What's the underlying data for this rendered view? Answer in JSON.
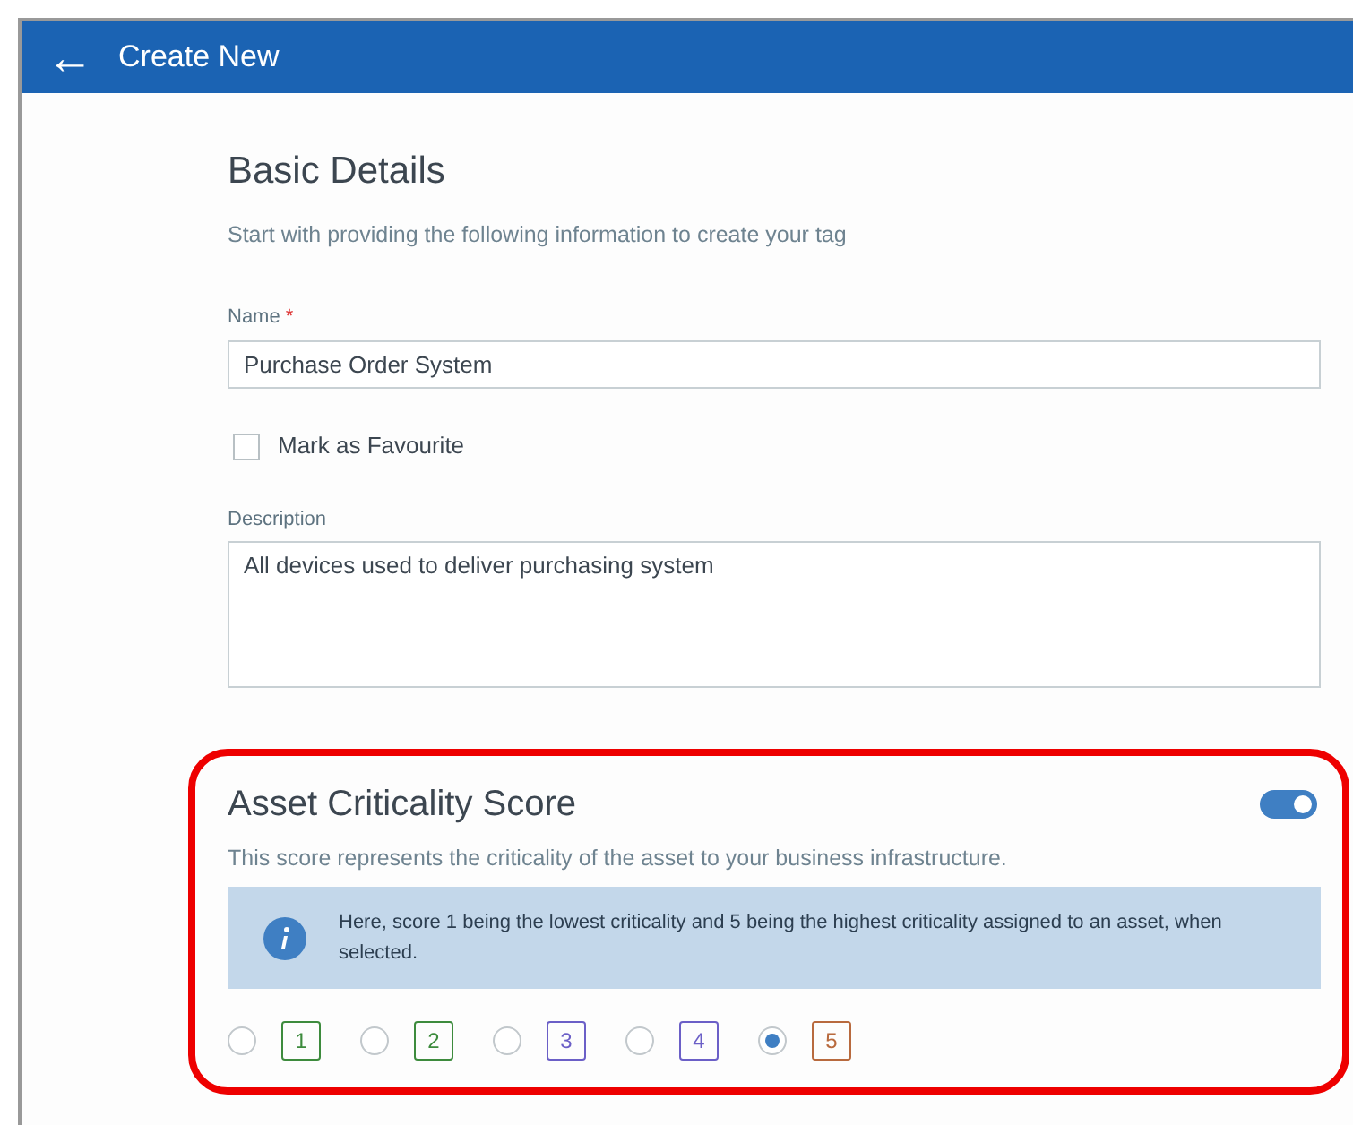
{
  "header": {
    "back_icon": "←",
    "title": "Create New"
  },
  "basic_details": {
    "title": "Basic Details",
    "subtitle": "Start with providing the following information to create your tag",
    "name_label": "Name",
    "required_mark": "*",
    "name_value": "Purchase Order System",
    "favourite": {
      "label": "Mark as Favourite",
      "checked": false
    },
    "description_label": "Description",
    "description_value": "All devices used to deliver purchasing system"
  },
  "criticality": {
    "title": "Asset Criticality Score",
    "enabled": true,
    "subtitle": "This score represents the criticality of the asset to your business infrastructure.",
    "info": "Here, score 1 being the lowest criticality and 5 being the highest criticality assigned to an asset, when selected.",
    "highlighted": true,
    "scores": [
      {
        "label": "1",
        "color": "#3d8b3d",
        "selected": false
      },
      {
        "label": "2",
        "color": "#3d8b3d",
        "selected": false
      },
      {
        "label": "3",
        "color": "#6b5fc7",
        "selected": false
      },
      {
        "label": "4",
        "color": "#6b5fc7",
        "selected": false
      },
      {
        "label": "5",
        "color": "#b86a3e",
        "selected": true
      }
    ]
  }
}
